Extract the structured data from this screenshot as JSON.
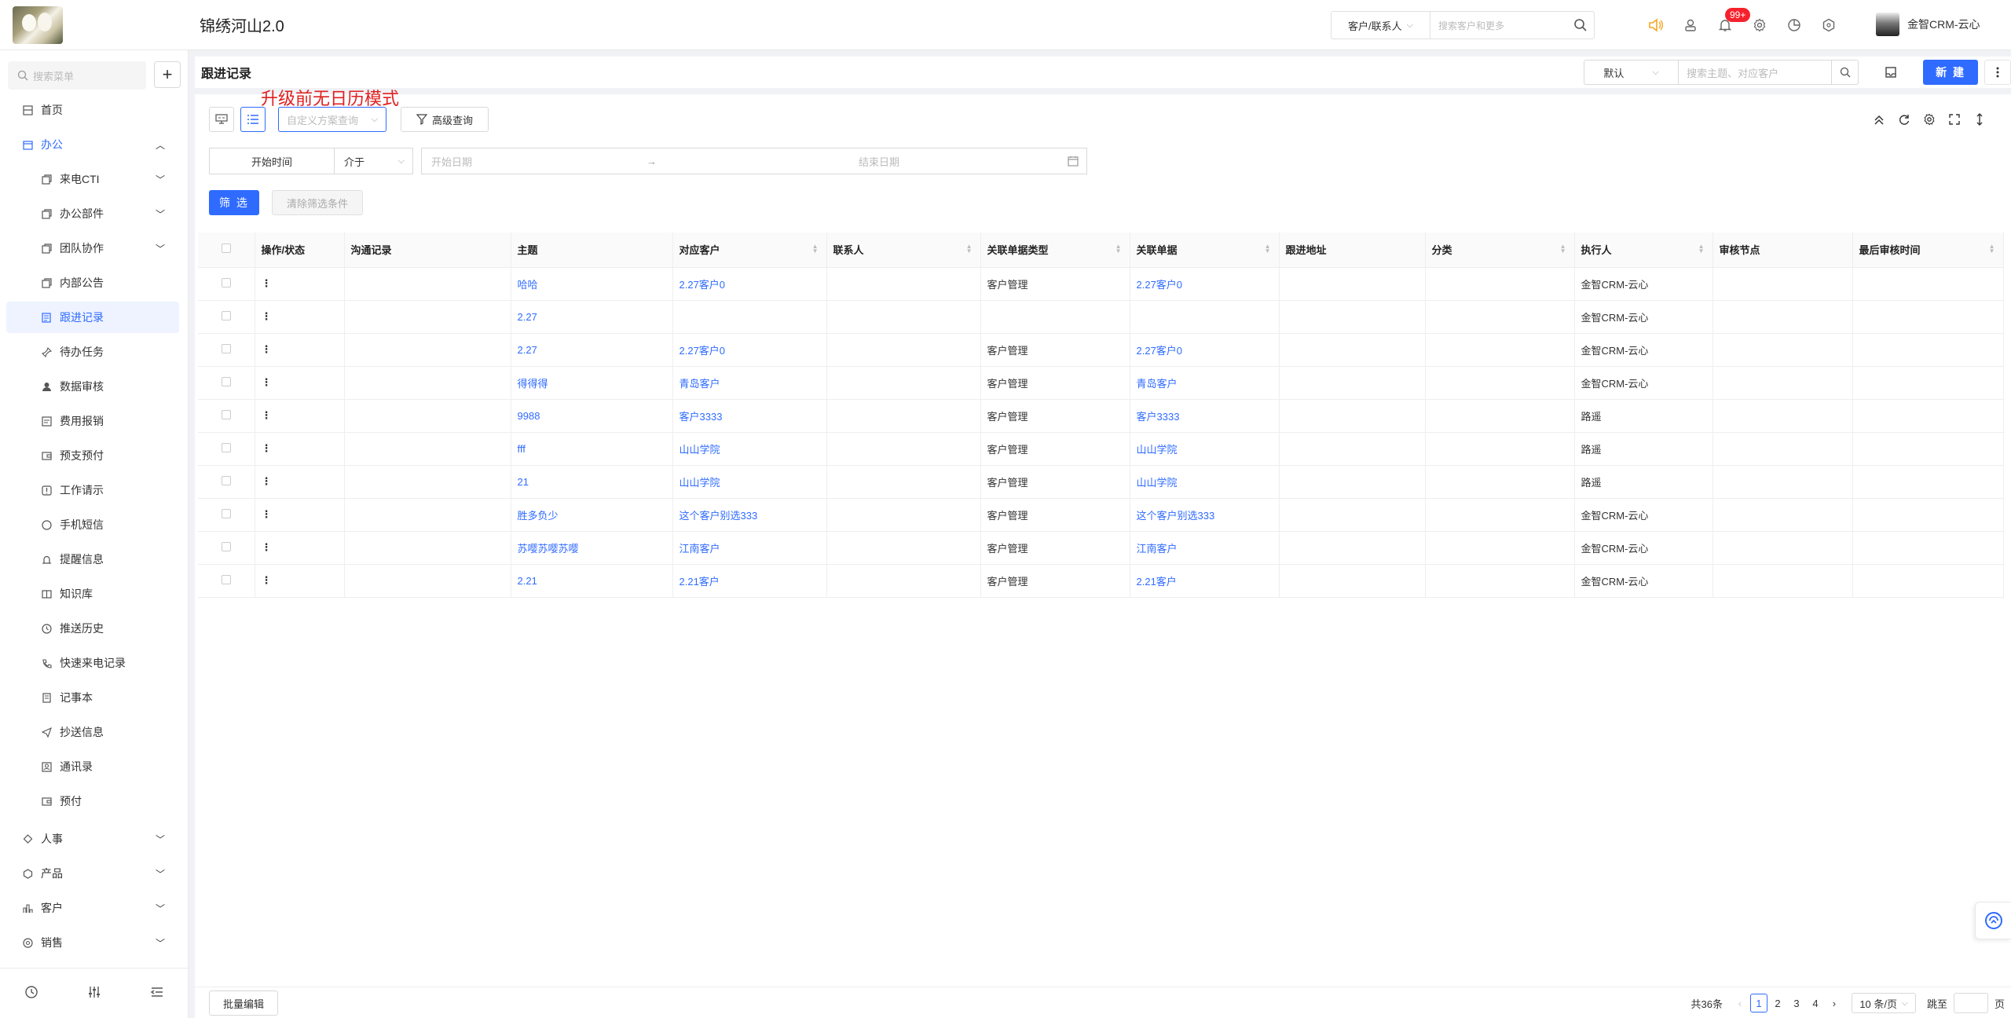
{
  "header": {
    "app_title": "锦绣河山2.0",
    "search_type": "客户/联系人",
    "search_placeholder": "搜索客户和更多",
    "notification_badge": "99+",
    "user_name": "金智CRM-云心"
  },
  "sidebar": {
    "search_placeholder": "搜索菜单",
    "items": [
      {
        "label": "首页",
        "icon": "home-icon"
      },
      {
        "label": "办公",
        "icon": "office-icon"
      },
      {
        "label": "来电CTI",
        "icon": "phone-icon"
      },
      {
        "label": "办公部件",
        "icon": "widget-icon"
      },
      {
        "label": "团队协作",
        "icon": "team-icon"
      },
      {
        "label": "内部公告",
        "icon": "notice-icon"
      },
      {
        "label": "跟进记录",
        "icon": "record-icon"
      },
      {
        "label": "待办任务",
        "icon": "pin-icon"
      },
      {
        "label": "数据审核",
        "icon": "user-icon"
      },
      {
        "label": "费用报销",
        "icon": "receipt-icon"
      },
      {
        "label": "预支预付",
        "icon": "wallet-icon"
      },
      {
        "label": "工作请示",
        "icon": "request-icon"
      },
      {
        "label": "手机短信",
        "icon": "message-icon"
      },
      {
        "label": "提醒信息",
        "icon": "bell-icon"
      },
      {
        "label": "知识库",
        "icon": "book-icon"
      },
      {
        "label": "推送历史",
        "icon": "clock-icon"
      },
      {
        "label": "快速来电记录",
        "icon": "phone-log-icon"
      },
      {
        "label": "记事本",
        "icon": "notebook-icon"
      },
      {
        "label": "抄送信息",
        "icon": "send-icon"
      },
      {
        "label": "通讯录",
        "icon": "contacts-icon"
      },
      {
        "label": "预付",
        "icon": "prepay-icon"
      },
      {
        "label": "人事",
        "icon": "hr-icon"
      },
      {
        "label": "产品",
        "icon": "product-icon"
      },
      {
        "label": "客户",
        "icon": "customer-icon"
      },
      {
        "label": "销售",
        "icon": "sales-icon"
      }
    ]
  },
  "page": {
    "title": "跟进记录",
    "view_select": "默认",
    "search_placeholder": "搜索主题、对应客户",
    "new_button": "新 建",
    "annotation": "升级前无日历模式"
  },
  "toolbar": {
    "scheme_placeholder": "自定义方案查询",
    "advanced_query": "高级查询"
  },
  "filter": {
    "field": "开始时间",
    "operator": "介于",
    "start_placeholder": "开始日期",
    "end_placeholder": "结束日期",
    "arrow": "→",
    "filter_button": "筛 选",
    "clear_button": "清除筛选条件"
  },
  "table": {
    "headers": [
      "操作/状态",
      "沟通记录",
      "主题",
      "对应客户",
      "联系人",
      "关联单据类型",
      "关联单据",
      "跟进地址",
      "分类",
      "执行人",
      "审核节点",
      "最后审核时间"
    ],
    "rows": [
      {
        "op": "⋮",
        "record": "",
        "subject": "哈哈",
        "customer": "2.27客户0",
        "contact": "",
        "doc_type": "客户管理",
        "doc": "2.27客户0",
        "address": "",
        "category": "",
        "executor": "金智CRM-云心",
        "node": "",
        "last_time": ""
      },
      {
        "op": "⋮",
        "record": "",
        "subject": "2.27",
        "customer": "",
        "contact": "",
        "doc_type": "",
        "doc": "",
        "address": "",
        "category": "",
        "executor": "金智CRM-云心",
        "node": "",
        "last_time": ""
      },
      {
        "op": "⋮",
        "record": "",
        "subject": "2.27",
        "customer": "2.27客户0",
        "contact": "",
        "doc_type": "客户管理",
        "doc": "2.27客户0",
        "address": "",
        "category": "",
        "executor": "金智CRM-云心",
        "node": "",
        "last_time": ""
      },
      {
        "op": "⋮",
        "record": "",
        "subject": "得得得",
        "customer": "青岛客户",
        "contact": "",
        "doc_type": "客户管理",
        "doc": "青岛客户",
        "address": "",
        "category": "",
        "executor": "金智CRM-云心",
        "node": "",
        "last_time": ""
      },
      {
        "op": "⋮",
        "record": "",
        "subject": "9988",
        "customer": "客户3333",
        "contact": "",
        "doc_type": "客户管理",
        "doc": "客户3333",
        "address": "",
        "category": "",
        "executor": "路遥",
        "node": "",
        "last_time": ""
      },
      {
        "op": "⋮",
        "record": "",
        "subject": "fff",
        "customer": "山山学院",
        "contact": "",
        "doc_type": "客户管理",
        "doc": "山山学院",
        "address": "",
        "category": "",
        "executor": "路遥",
        "node": "",
        "last_time": ""
      },
      {
        "op": "⋮",
        "record": "",
        "subject": "21",
        "customer": "山山学院",
        "contact": "",
        "doc_type": "客户管理",
        "doc": "山山学院",
        "address": "",
        "category": "",
        "executor": "路遥",
        "node": "",
        "last_time": ""
      },
      {
        "op": "⋮",
        "record": "",
        "subject": "胜多负少",
        "customer": "这个客户别选333",
        "contact": "",
        "doc_type": "客户管理",
        "doc": "这个客户别选333",
        "address": "",
        "category": "",
        "executor": "金智CRM-云心",
        "node": "",
        "last_time": ""
      },
      {
        "op": "⋮",
        "record": "",
        "subject": "苏嘤苏嘤苏嘤",
        "customer": "江南客户",
        "contact": "",
        "doc_type": "客户管理",
        "doc": "江南客户",
        "address": "",
        "category": "",
        "executor": "金智CRM-云心",
        "node": "",
        "last_time": ""
      },
      {
        "op": "⋮",
        "record": "",
        "subject": "2.21",
        "customer": "2.21客户",
        "contact": "",
        "doc_type": "客户管理",
        "doc": "2.21客户",
        "address": "",
        "category": "",
        "executor": "金智CRM-云心",
        "node": "",
        "last_time": ""
      }
    ]
  },
  "footer": {
    "batch_edit": "批量编辑",
    "total": "共36条",
    "pages": [
      "1",
      "2",
      "3",
      "4"
    ],
    "current_page": "1",
    "page_size": "10 条/页",
    "jump_label": "跳至",
    "page_unit": "页"
  },
  "colors": {
    "primary": "#2f6bff",
    "annotation": "#e02020",
    "badge": "#f5222d"
  }
}
